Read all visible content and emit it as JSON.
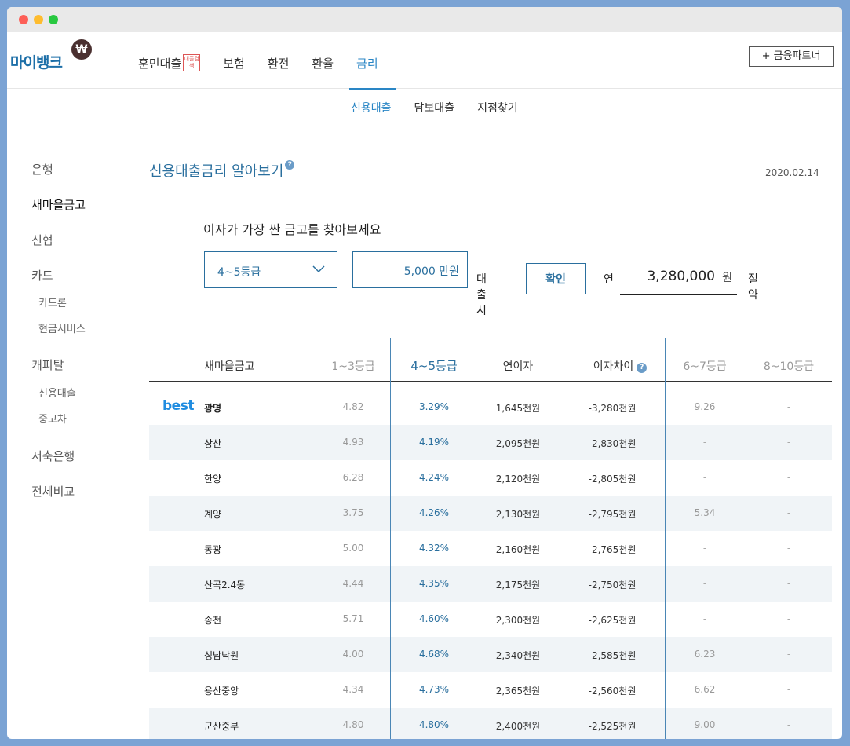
{
  "brand": {
    "logo_text": "마이뱅크",
    "logo_badge": "₩"
  },
  "nav": {
    "items": [
      {
        "label": "훈민대출",
        "stamp": "대출검색"
      },
      {
        "label": "보험"
      },
      {
        "label": "환전"
      },
      {
        "label": "환율"
      },
      {
        "label": "금리"
      }
    ],
    "active": "금리",
    "partner_button": "+ 금융파트너"
  },
  "subnav": {
    "items": [
      "신용대출",
      "담보대출",
      "지점찾기"
    ],
    "active": "신용대출"
  },
  "sidebar": {
    "items": [
      {
        "label": "은행"
      },
      {
        "label": "새마을금고"
      },
      {
        "label": "신협"
      },
      {
        "label": "카드"
      },
      {
        "label": "카드론"
      },
      {
        "label": "현금서비스"
      },
      {
        "label": "캐피탈"
      },
      {
        "label": "신용대출"
      },
      {
        "label": "중고차"
      },
      {
        "label": "저축은행"
      },
      {
        "label": "전체비교"
      }
    ],
    "active": "새마을금고"
  },
  "page": {
    "title": "신용대출금리 알아보기",
    "help": "?",
    "date": "2020.02.14",
    "subtitle": "이자가 가장 싼 금고를 찾아보세요"
  },
  "calculator": {
    "grade": "4~5등급",
    "amount": "5,000",
    "amount_unit": "만원",
    "loan_label": "대출시",
    "confirm_button": "확인",
    "year_label": "연",
    "saving_amount": "3,280,000",
    "saving_unit": "원",
    "saving_label": "절약"
  },
  "table": {
    "best_label": "best",
    "headers": [
      "새마을금고",
      "1~3등급",
      "4~5등급",
      "연이자",
      "이자차이",
      "6~7등급",
      "8~10등급"
    ],
    "rows": [
      [
        "광명",
        "4.82",
        "3.29%",
        "1,645천원",
        "-3,280천원",
        "9.26",
        "-"
      ],
      [
        "상산",
        "4.93",
        "4.19%",
        "2,095천원",
        "-2,830천원",
        "-",
        "-"
      ],
      [
        "한양",
        "6.28",
        "4.24%",
        "2,120천원",
        "-2,805천원",
        "-",
        "-"
      ],
      [
        "계양",
        "3.75",
        "4.26%",
        "2,130천원",
        "-2,795천원",
        "5.34",
        "-"
      ],
      [
        "동광",
        "5.00",
        "4.32%",
        "2,160천원",
        "-2,765천원",
        "-",
        "-"
      ],
      [
        "산곡2.4동",
        "4.44",
        "4.35%",
        "2,175천원",
        "-2,750천원",
        "-",
        "-"
      ],
      [
        "송천",
        "5.71",
        "4.60%",
        "2,300천원",
        "-2,625천원",
        "-",
        "-"
      ],
      [
        "성남낙원",
        "4.00",
        "4.68%",
        "2,340천원",
        "-2,585천원",
        "6.23",
        "-"
      ],
      [
        "용산중앙",
        "4.34",
        "4.73%",
        "2,365천원",
        "-2,560천원",
        "6.62",
        "-"
      ],
      [
        "군산중부",
        "4.80",
        "4.80%",
        "2,400천원",
        "-2,525천원",
        "9.00",
        "-"
      ]
    ]
  },
  "colors": {
    "accent": "#2a86c5",
    "title": "#2a6f9e",
    "best": "#1f8ce0",
    "row_alt": "#f0f4f7"
  }
}
